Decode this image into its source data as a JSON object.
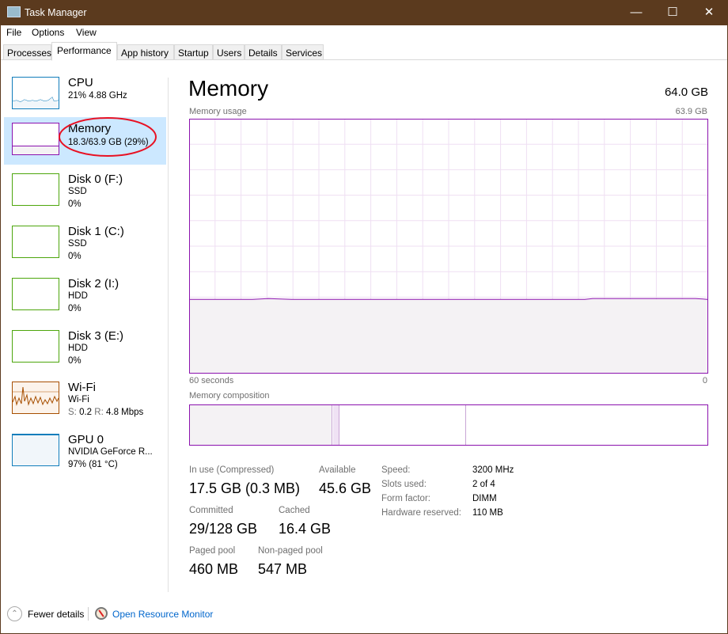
{
  "window": {
    "title": "Task Manager"
  },
  "menu": [
    "File",
    "Options",
    "View"
  ],
  "tabs": [
    "Processes",
    "Performance",
    "App history",
    "Startup",
    "Users",
    "Details",
    "Services"
  ],
  "active_tab": "Performance",
  "sidebar": [
    {
      "name": "CPU",
      "sub1": "21% 4.88 GHz",
      "color": "#117dbb"
    },
    {
      "name": "Memory",
      "sub1": "18.3/63.9 GB (29%)",
      "color": "#8b12ae"
    },
    {
      "name": "Disk 0 (F:)",
      "sub1": "SSD",
      "sub2": "0%",
      "color": "#4da60c"
    },
    {
      "name": "Disk 1 (C:)",
      "sub1": "SSD",
      "sub2": "0%",
      "color": "#4da60c"
    },
    {
      "name": "Disk 2 (I:)",
      "sub1": "HDD",
      "sub2": "0%",
      "color": "#4da60c"
    },
    {
      "name": "Disk 3 (E:)",
      "sub1": "HDD",
      "sub2": "0%",
      "color": "#4da60c"
    },
    {
      "name": "Wi-Fi",
      "sub1": "Wi-Fi",
      "sub2_s": "S:",
      "sub2_sv": "0.2",
      "sub2_r": "R:",
      "sub2_rv": "4.8 Mbps",
      "color": "#a74f01"
    },
    {
      "name": "GPU 0",
      "sub1": "NVIDIA GeForce R...",
      "sub2": "97% (81 °C)",
      "color": "#117dbb"
    }
  ],
  "main": {
    "title": "Memory",
    "total": "64.0 GB",
    "usage_label": "Memory usage",
    "usage_max": "63.9 GB",
    "time_left": "60 seconds",
    "time_right": "0",
    "usage_percent": 29,
    "composition_label": "Memory composition",
    "stats": {
      "in_use_label": "In use (Compressed)",
      "in_use": "17.5 GB (0.3 MB)",
      "available_label": "Available",
      "available": "45.6 GB",
      "committed_label": "Committed",
      "committed": "29/128 GB",
      "cached_label": "Cached",
      "cached": "16.4 GB",
      "paged_label": "Paged pool",
      "paged": "460 MB",
      "nonpaged_label": "Non-paged pool",
      "nonpaged": "547 MB"
    },
    "details": [
      {
        "k": "Speed:",
        "v": "3200 MHz"
      },
      {
        "k": "Slots used:",
        "v": "2 of 4"
      },
      {
        "k": "Form factor:",
        "v": "DIMM"
      },
      {
        "k": "Hardware reserved:",
        "v": "110 MB"
      }
    ]
  },
  "footer": {
    "fewer": "Fewer details",
    "monitor": "Open Resource Monitor"
  },
  "colors": {
    "titlebar": "#5b3a1e",
    "memory": "#8b12ae",
    "highlight": "#e81123",
    "link": "#0066cc"
  }
}
